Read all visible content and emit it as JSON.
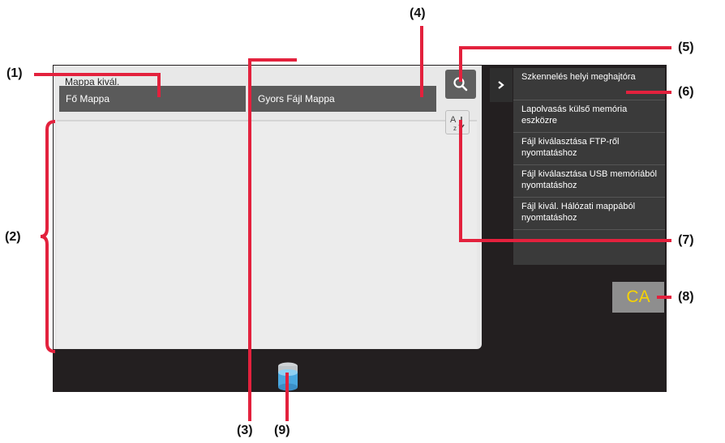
{
  "screen": {
    "title": "Mappa kivál.",
    "tabs": [
      {
        "label": "Fő Mappa"
      },
      {
        "label": "Gyors Fájl Mappa"
      }
    ],
    "icons": {
      "search": "search-icon",
      "sort": "sort-az-icon",
      "chevron": "chevron-right-icon",
      "storage": "storage-icon"
    }
  },
  "sidebar": {
    "items": [
      {
        "label": "Szkennelés helyi meghajtóra"
      },
      {
        "label": "Lapolvasás külső memória eszközre"
      },
      {
        "label": "Fájl kiválasztása FTP-ről nyomtatáshoz"
      },
      {
        "label": "Fájl kiválasztása USB memóriából nyomtatáshoz"
      },
      {
        "label": "Fájl kivál. Hálózati mappából nyomtatáshoz"
      }
    ]
  },
  "ca_button": {
    "label": "CA"
  },
  "callouts": {
    "c1": "(1)",
    "c2": "(2)",
    "c3": "(3)",
    "c4": "(4)",
    "c5": "(5)",
    "c6": "(6)",
    "c7": "(7)",
    "c8": "(8)",
    "c9": "(9)"
  },
  "colors": {
    "accent": "#e3213d",
    "ca_text": "#f6d300"
  }
}
